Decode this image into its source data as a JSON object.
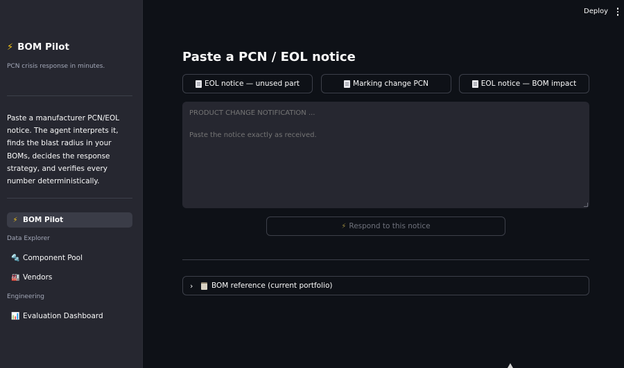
{
  "toolbar": {
    "deploy_label": "Deploy",
    "menu_icon": "kebab-menu-icon"
  },
  "sidebar": {
    "brand": "BOM Pilot",
    "brand_icon": "lightning-bolt-icon",
    "tagline": "PCN crisis response in minutes.",
    "description": "Paste a manufacturer PCN/EOL notice. The agent interprets it, finds the blast radius in your BOMs, decides the response strategy, and verifies every number deterministically.",
    "nav": {
      "home": {
        "label": "BOM Pilot",
        "icon": "lightning-bolt-icon",
        "active": true
      },
      "section_data": "Data Explorer",
      "component_pool": {
        "label": "Component Pool",
        "icon": "wrench-icon"
      },
      "vendors": {
        "label": "Vendors",
        "icon": "factory-icon"
      },
      "section_eng": "Engineering",
      "eval_dashboard": {
        "label": "Evaluation Dashboard",
        "icon": "bar-chart-icon"
      }
    }
  },
  "main": {
    "title": "Paste a PCN / EOL notice",
    "examples": [
      {
        "label": "EOL notice — unused part",
        "icon": "document-icon"
      },
      {
        "label": "Marking change PCN",
        "icon": "document-icon"
      },
      {
        "label": "EOL notice — BOM impact",
        "icon": "document-icon"
      }
    ],
    "notice_placeholder": "PRODUCT CHANGE NOTIFICATION ...\n\nPaste the notice exactly as received.",
    "respond_label": "Respond to this notice",
    "respond_icon": "lightning-bolt-icon",
    "expander_label": "BOM reference (current portfolio)",
    "expander_icon": "clipboard-icon"
  },
  "colors": {
    "app_background": "#0e1117",
    "sidebar_background": "#262730",
    "input_background": "#262730",
    "border": "#3d404a",
    "text": "#fafafa",
    "muted_text": "#a3a8b8",
    "bolt": "#f5c518"
  }
}
